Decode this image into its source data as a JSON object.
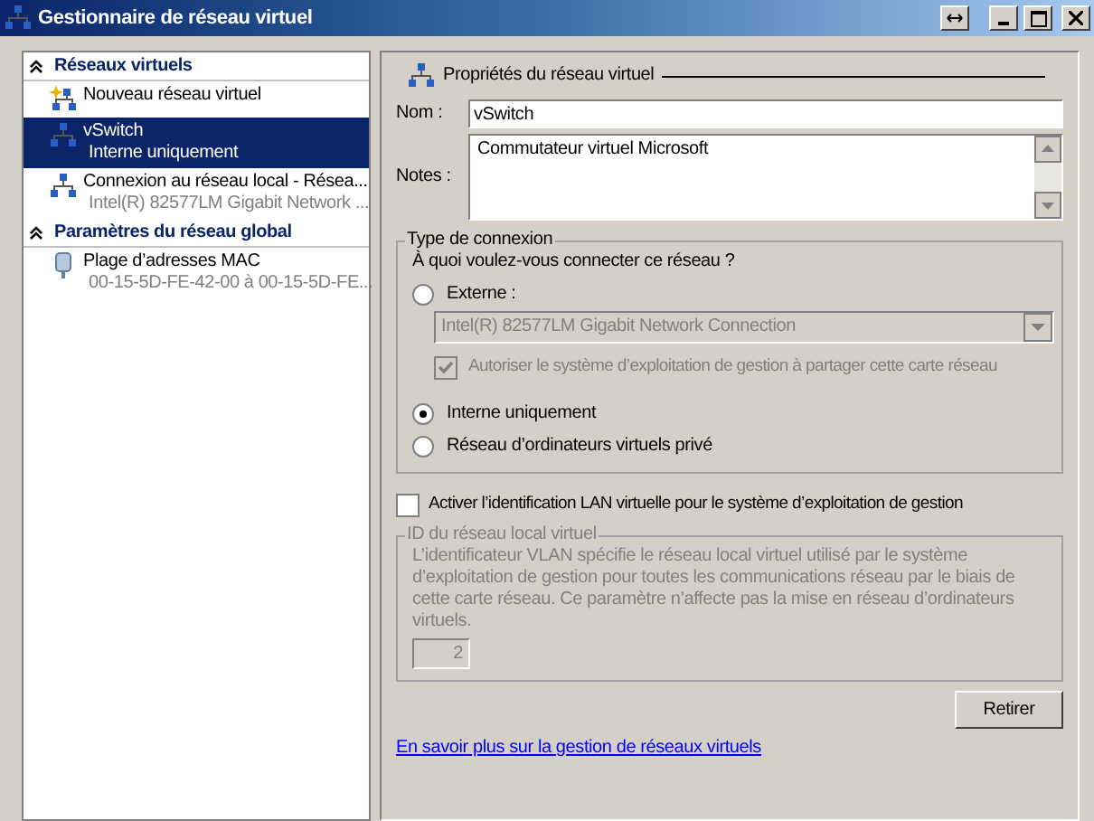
{
  "window": {
    "title": "Gestionnaire de réseau virtuel"
  },
  "sidebar": {
    "sections": [
      {
        "title": "Réseaux virtuels",
        "expanded": true,
        "items": [
          {
            "kind": "new",
            "label": "Nouveau réseau virtuel",
            "selected": false
          },
          {
            "kind": "network",
            "label": "vSwitch",
            "sublabel": "Interne uniquement",
            "selected": true
          },
          {
            "kind": "network",
            "label": "Connexion au réseau local - Résea...",
            "sublabel": "Intel(R) 82577LM Gigabit Network ...",
            "selected": false
          }
        ]
      },
      {
        "title": "Paramètres du réseau global",
        "expanded": true,
        "items": [
          {
            "kind": "mac",
            "label": "Plage d’adresses MAC",
            "sublabel": "00-15-5D-FE-42-00 à 00-15-5D-FE...",
            "selected": false
          }
        ]
      }
    ]
  },
  "properties": {
    "heading": "Propriétés du réseau virtuel",
    "name_label": "Nom :",
    "name_value": "vSwitch",
    "notes_label": "Notes :",
    "notes_value": "Commutateur virtuel Microsoft"
  },
  "connection_type": {
    "legend": "Type de connexion",
    "question": "À quoi voulez-vous connecter ce réseau ?",
    "options": [
      {
        "kind": "external",
        "label": "Externe :",
        "selected": false,
        "adapter": "Intel(R) 82577LM Gigabit Network Connection",
        "share_label": "Autoriser le système d’exploitation de gestion à partager cette carte réseau",
        "share_checked": true,
        "disabled": true
      },
      {
        "kind": "plain",
        "label": "Interne uniquement",
        "selected": true
      },
      {
        "kind": "plain",
        "label": "Réseau d’ordinateurs virtuels privé",
        "selected": false
      }
    ]
  },
  "vlan": {
    "checkbox_label": "Activer l’identification LAN virtuelle pour le système d’exploitation de gestion",
    "checked": false,
    "legend": "ID du réseau local virtuel",
    "description": "L’identificateur VLAN spécifie le réseau local virtuel utilisé par le système d’exploitation de gestion pour toutes les communications réseau par le biais de cette carte réseau. Ce paramètre n’affecte pas la mise en réseau d’ordinateurs virtuels.",
    "id_value": "2",
    "disabled": true
  },
  "remove_button": "Retirer",
  "help_link": "En savoir plus sur la gestion de réseaux virtuels"
}
